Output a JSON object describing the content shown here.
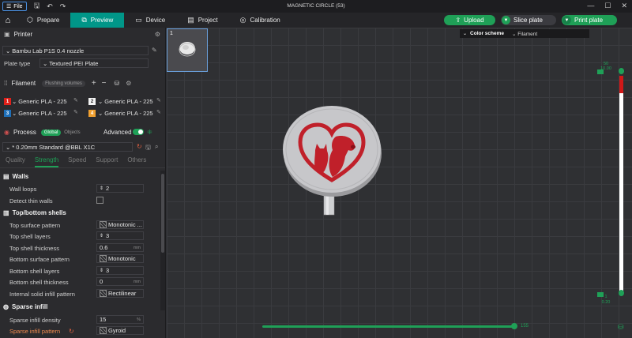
{
  "titlebar": {
    "file_label": "File",
    "title": "MAGNETIC CIRCLE (53)"
  },
  "tabs": [
    {
      "label": "Prepare",
      "icon": "cube-icon"
    },
    {
      "label": "Preview",
      "icon": "preview-icon"
    },
    {
      "label": "Device",
      "icon": "device-icon"
    },
    {
      "label": "Project",
      "icon": "project-icon"
    },
    {
      "label": "Calibration",
      "icon": "calibration-icon"
    }
  ],
  "actions": {
    "upload": "Upload",
    "slice": "Slice plate",
    "print": "Print plate"
  },
  "printer": {
    "header": "Printer",
    "name": "Bambu Lab P1S 0.4 nozzle",
    "plate_label": "Plate type",
    "plate_value": "Textured PEI Plate"
  },
  "filament": {
    "header": "Filament",
    "flushing": "Flushing volumes",
    "items": [
      {
        "num": "1",
        "name": "Generic PLA - 225",
        "color": "#e0201a"
      },
      {
        "num": "2",
        "name": "Generic PLA - 225",
        "color": "#f2f2f2"
      },
      {
        "num": "3",
        "name": "Generic PLA - 225",
        "color": "#1e6fb8"
      },
      {
        "num": "4",
        "name": "Generic PLA - 225",
        "color": "#f0a030"
      }
    ]
  },
  "process": {
    "header": "Process",
    "global": "Global",
    "objects": "Objects",
    "advanced": "Advanced",
    "preset": "* 0.20mm Standard @BBL X1C",
    "subtabs": [
      "Quality",
      "Strength",
      "Speed",
      "Support",
      "Others"
    ],
    "active_subtab": "Strength"
  },
  "settings": {
    "walls": "Walls",
    "wall_loops_label": "Wall loops",
    "wall_loops_value": "2",
    "detect_thin": "Detect thin walls",
    "topbottom": "Top/bottom shells",
    "top_pattern_label": "Top surface pattern",
    "top_pattern_value": "Monotonic ...",
    "top_layers_label": "Top shell layers",
    "top_layers_value": "3",
    "top_thick_label": "Top shell thickness",
    "top_thick_value": "0.6",
    "bottom_pattern_label": "Bottom surface pattern",
    "bottom_pattern_value": "Monotonic",
    "bottom_layers_label": "Bottom shell layers",
    "bottom_layers_value": "3",
    "bottom_thick_label": "Bottom shell thickness",
    "bottom_thick_value": "0",
    "internal_pattern_label": "Internal solid infill pattern",
    "internal_pattern_value": "Rectilinear",
    "sparse": "Sparse infill",
    "density_label": "Sparse infill density",
    "density_value": "15",
    "sparse_pattern_label": "Sparse infill pattern",
    "sparse_pattern_value": "Gyroid",
    "unit_mm": "mm",
    "unit_pct": "%"
  },
  "viewport": {
    "plate_num": "1",
    "color_scheme_label": "Color scheme",
    "color_scheme_value": "Filament",
    "layer_top": "50",
    "layer_top_h": "10.00",
    "layer_bottom": "1",
    "layer_bottom_h": "0.20",
    "move_count": "155"
  }
}
